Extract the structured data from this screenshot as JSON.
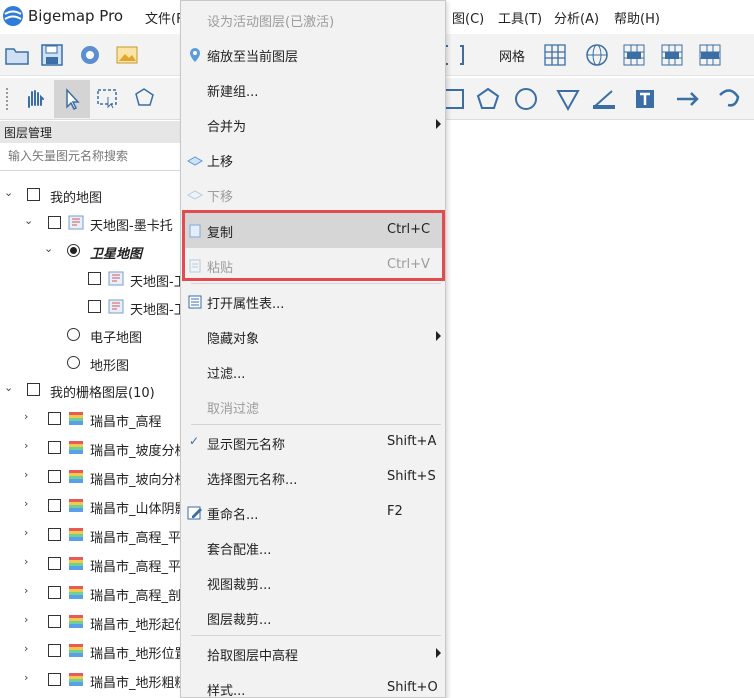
{
  "app": {
    "title": "Bigemap Pro"
  },
  "menubar": {
    "file": "文件(F",
    "map_partial": "图(C)",
    "tools": "工具(T)",
    "analysis": "分析(A)",
    "help": "帮助(H)"
  },
  "toolbar": {
    "grid_label": "网格"
  },
  "layer_panel": {
    "header": "图层管理",
    "search_placeholder": "输入矢量图元名称搜索",
    "nodes": [
      {
        "label": "我的地图"
      },
      {
        "label": "天地图-墨卡托"
      },
      {
        "label": "卫星地图"
      },
      {
        "label": "天地图-卫"
      },
      {
        "label": "天地图-卫"
      },
      {
        "label": "电子地图"
      },
      {
        "label": "地形图"
      },
      {
        "label": "我的栅格图层(10)"
      },
      {
        "label": "瑞昌市_高程"
      },
      {
        "label": "瑞昌市_坡度分析"
      },
      {
        "label": "瑞昌市_坡向分析"
      },
      {
        "label": "瑞昌市_山体阴影"
      },
      {
        "label": "瑞昌市_高程_平"
      },
      {
        "label": "瑞昌市_高程_平"
      },
      {
        "label": "瑞昌市_高程_剖"
      },
      {
        "label": "瑞昌市_地形起伏"
      },
      {
        "label": "瑞昌市_地形位置"
      },
      {
        "label": "瑞昌市_地形粗糙"
      }
    ]
  },
  "context_menu": {
    "items": [
      {
        "label": "设为活动图层(已激活)",
        "shortcut": ""
      },
      {
        "label": "缩放至当前图层",
        "shortcut": ""
      },
      {
        "label": "新建组...",
        "shortcut": ""
      },
      {
        "label": "合并为",
        "shortcut": ""
      },
      {
        "label": "上移",
        "shortcut": ""
      },
      {
        "label": "下移",
        "shortcut": ""
      },
      {
        "label": "复制",
        "shortcut": "Ctrl+C"
      },
      {
        "label": "粘贴",
        "shortcut": "Ctrl+V"
      },
      {
        "label": "打开属性表...",
        "shortcut": ""
      },
      {
        "label": "隐藏对象",
        "shortcut": ""
      },
      {
        "label": "过滤...",
        "shortcut": ""
      },
      {
        "label": "取消过滤",
        "shortcut": ""
      },
      {
        "label": "显示图元名称",
        "shortcut": "Shift+A"
      },
      {
        "label": "选择图元名称...",
        "shortcut": "Shift+S"
      },
      {
        "label": "重命名...",
        "shortcut": "F2"
      },
      {
        "label": "套合配准...",
        "shortcut": ""
      },
      {
        "label": "视图裁剪...",
        "shortcut": ""
      },
      {
        "label": "图层裁剪...",
        "shortcut": ""
      },
      {
        "label": "拾取图层中高程",
        "shortcut": ""
      },
      {
        "label": "样式...",
        "shortcut": "Shift+O"
      }
    ]
  },
  "colors": {
    "accent": "#1a73c8",
    "highlight_border": "#e34b4e",
    "menu_bg": "#f2f2f2",
    "menu_hover": "#d6d6d6"
  }
}
